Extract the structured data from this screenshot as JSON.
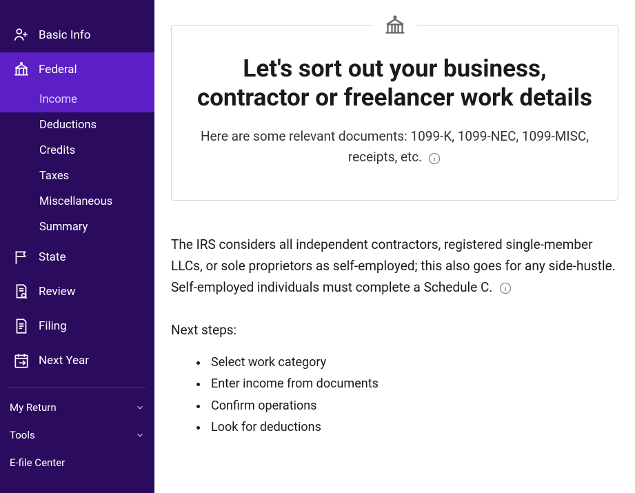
{
  "sidebar": {
    "nav": [
      {
        "label": "Basic Info",
        "icon": "user"
      },
      {
        "label": "Federal",
        "icon": "gov"
      },
      {
        "label": "State",
        "icon": "flag"
      },
      {
        "label": "Review",
        "icon": "doc-search"
      },
      {
        "label": "Filing",
        "icon": "doc"
      },
      {
        "label": "Next Year",
        "icon": "calendar"
      }
    ],
    "subnav": [
      "Income",
      "Deductions",
      "Credits",
      "Taxes",
      "Miscellaneous",
      "Summary"
    ],
    "footer": [
      {
        "label": "My Return",
        "expandable": true
      },
      {
        "label": "Tools",
        "expandable": true
      },
      {
        "label": "E-file Center",
        "expandable": false
      }
    ]
  },
  "main": {
    "title": "Let's sort out your business, contractor or freelancer work details",
    "subtitle": "Here are some relevant documents: 1099-K, 1099-NEC, 1099-MISC, receipts, etc.",
    "body": "The IRS considers all independent contractors, registered single-member LLCs, or sole proprietors as self-employed; this also goes for any side-hustle. Self-employed individuals must complete a Schedule C.",
    "next_steps_label": "Next steps:",
    "steps": [
      "Select work category",
      "Enter income from documents",
      "Confirm operations",
      "Look for deductions"
    ]
  }
}
